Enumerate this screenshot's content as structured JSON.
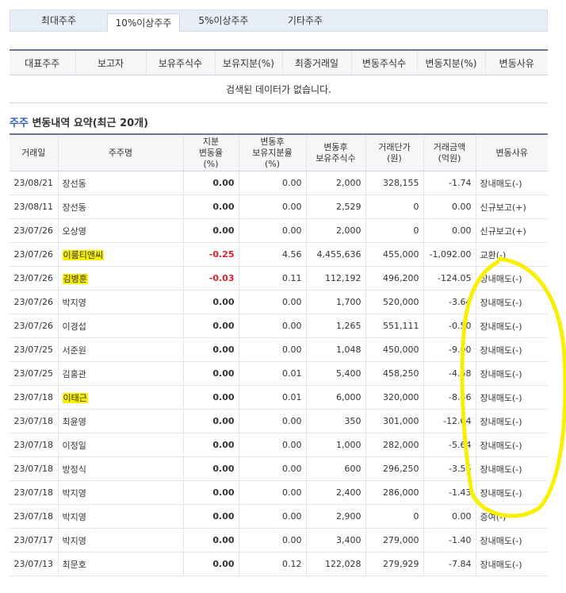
{
  "tabs": [
    "최대주주",
    "10%이상주주",
    "5%이상주주",
    "기타주주"
  ],
  "active_tab": 1,
  "major_table": {
    "headers": [
      "대표주주",
      "보고자",
      "보유주식수",
      "보유지분(%)",
      "최종거래일",
      "변동주식수",
      "변동지분(%)",
      "변동사유"
    ],
    "empty_message": "검색된 데이터가 없습니다."
  },
  "summary": {
    "title_highlight": "주주",
    "title_rest": " 변동내역 요약(최근 20개)"
  },
  "changes_table": {
    "headers": {
      "date": "거래일",
      "name": "주주명",
      "rate_l1": "지분",
      "rate_l2": "변동율",
      "rate_l3": "(%)",
      "after_l1": "변동후",
      "after_l2": "보유지분율",
      "after_l3": "(%)",
      "shares_l1": "변동후",
      "shares_l2": "보유주식수",
      "price_l1": "거래단가",
      "price_l2": "(원)",
      "amount_l1": "거래금액",
      "amount_l2": "(억원)",
      "reason": "변동사유"
    },
    "rows": [
      {
        "date": "23/08/21",
        "name": "장선동",
        "rate": "0.00",
        "after": "0.00",
        "shares": "2,000",
        "price": "328,155",
        "amount": "-1.74",
        "reason": "장내매도(-)",
        "neg": false,
        "hl": false
      },
      {
        "date": "23/08/11",
        "name": "장선동",
        "rate": "0.00",
        "after": "0.00",
        "shares": "2,529",
        "price": "0",
        "amount": "0.00",
        "reason": "신규보고(+)",
        "neg": false,
        "hl": false
      },
      {
        "date": "23/07/26",
        "name": "오상영",
        "rate": "0.00",
        "after": "0.00",
        "shares": "2,000",
        "price": "0",
        "amount": "0.00",
        "reason": "신규보고(+)",
        "neg": false,
        "hl": false
      },
      {
        "date": "23/07/26",
        "name": "이룸티앤씨",
        "rate": "-0.25",
        "after": "4.56",
        "shares": "4,455,636",
        "price": "455,000",
        "amount": "-1,092.00",
        "reason": "교환(-)",
        "neg": true,
        "hl": true
      },
      {
        "date": "23/07/26",
        "name": "김병훈",
        "rate": "-0.03",
        "after": "0.11",
        "shares": "112,192",
        "price": "496,200",
        "amount": "-124.05",
        "reason": "장내매도(-)",
        "neg": true,
        "hl": true
      },
      {
        "date": "23/07/26",
        "name": "박지영",
        "rate": "0.00",
        "after": "0.00",
        "shares": "1,700",
        "price": "520,000",
        "amount": "-3.64",
        "reason": "장내매도(-)",
        "neg": false,
        "hl": false
      },
      {
        "date": "23/07/26",
        "name": "이경섭",
        "rate": "0.00",
        "after": "0.00",
        "shares": "1,265",
        "price": "551,111",
        "amount": "-0.50",
        "reason": "장내매도(-)",
        "neg": false,
        "hl": false
      },
      {
        "date": "23/07/25",
        "name": "서준원",
        "rate": "0.00",
        "after": "0.00",
        "shares": "1,048",
        "price": "450,000",
        "amount": "-9.00",
        "reason": "장내매도(-)",
        "neg": false,
        "hl": false
      },
      {
        "date": "23/07/25",
        "name": "김홍관",
        "rate": "0.00",
        "after": "0.01",
        "shares": "5,400",
        "price": "458,250",
        "amount": "-4.58",
        "reason": "장내매도(-)",
        "neg": false,
        "hl": false
      },
      {
        "date": "23/07/18",
        "name": "이태근",
        "rate": "0.00",
        "after": "0.01",
        "shares": "6,000",
        "price": "320,000",
        "amount": "-8.56",
        "reason": "장내매도(-)",
        "neg": false,
        "hl": true
      },
      {
        "date": "23/07/18",
        "name": "최윤영",
        "rate": "0.00",
        "after": "0.00",
        "shares": "350",
        "price": "301,000",
        "amount": "-12.04",
        "reason": "장내매도(-)",
        "neg": false,
        "hl": false
      },
      {
        "date": "23/07/18",
        "name": "이정일",
        "rate": "0.00",
        "after": "0.00",
        "shares": "1,000",
        "price": "282,000",
        "amount": "-5.64",
        "reason": "장내매도(-)",
        "neg": false,
        "hl": false
      },
      {
        "date": "23/07/18",
        "name": "방정식",
        "rate": "0.00",
        "after": "0.00",
        "shares": "600",
        "price": "296,250",
        "amount": "-3.56",
        "reason": "장내매도(-)",
        "neg": false,
        "hl": false
      },
      {
        "date": "23/07/18",
        "name": "박지영",
        "rate": "0.00",
        "after": "0.00",
        "shares": "2,400",
        "price": "286,000",
        "amount": "-1.43",
        "reason": "장내매도(-)",
        "neg": false,
        "hl": false
      },
      {
        "date": "23/07/18",
        "name": "박지영",
        "rate": "0.00",
        "after": "0.00",
        "shares": "2,900",
        "price": "0",
        "amount": "0.00",
        "reason": "증여(-)",
        "neg": false,
        "hl": false
      },
      {
        "date": "23/07/17",
        "name": "박지영",
        "rate": "0.00",
        "after": "0.00",
        "shares": "3,400",
        "price": "279,000",
        "amount": "-1.40",
        "reason": "장내매도(-)",
        "neg": false,
        "hl": false
      },
      {
        "date": "23/07/13",
        "name": "최문호",
        "rate": "0.00",
        "after": "0.12",
        "shares": "122,028",
        "price": "279,929",
        "amount": "-7.84",
        "reason": "장내매도(-)",
        "neg": false,
        "hl": false
      }
    ]
  },
  "annotation_color": "#f8f000"
}
